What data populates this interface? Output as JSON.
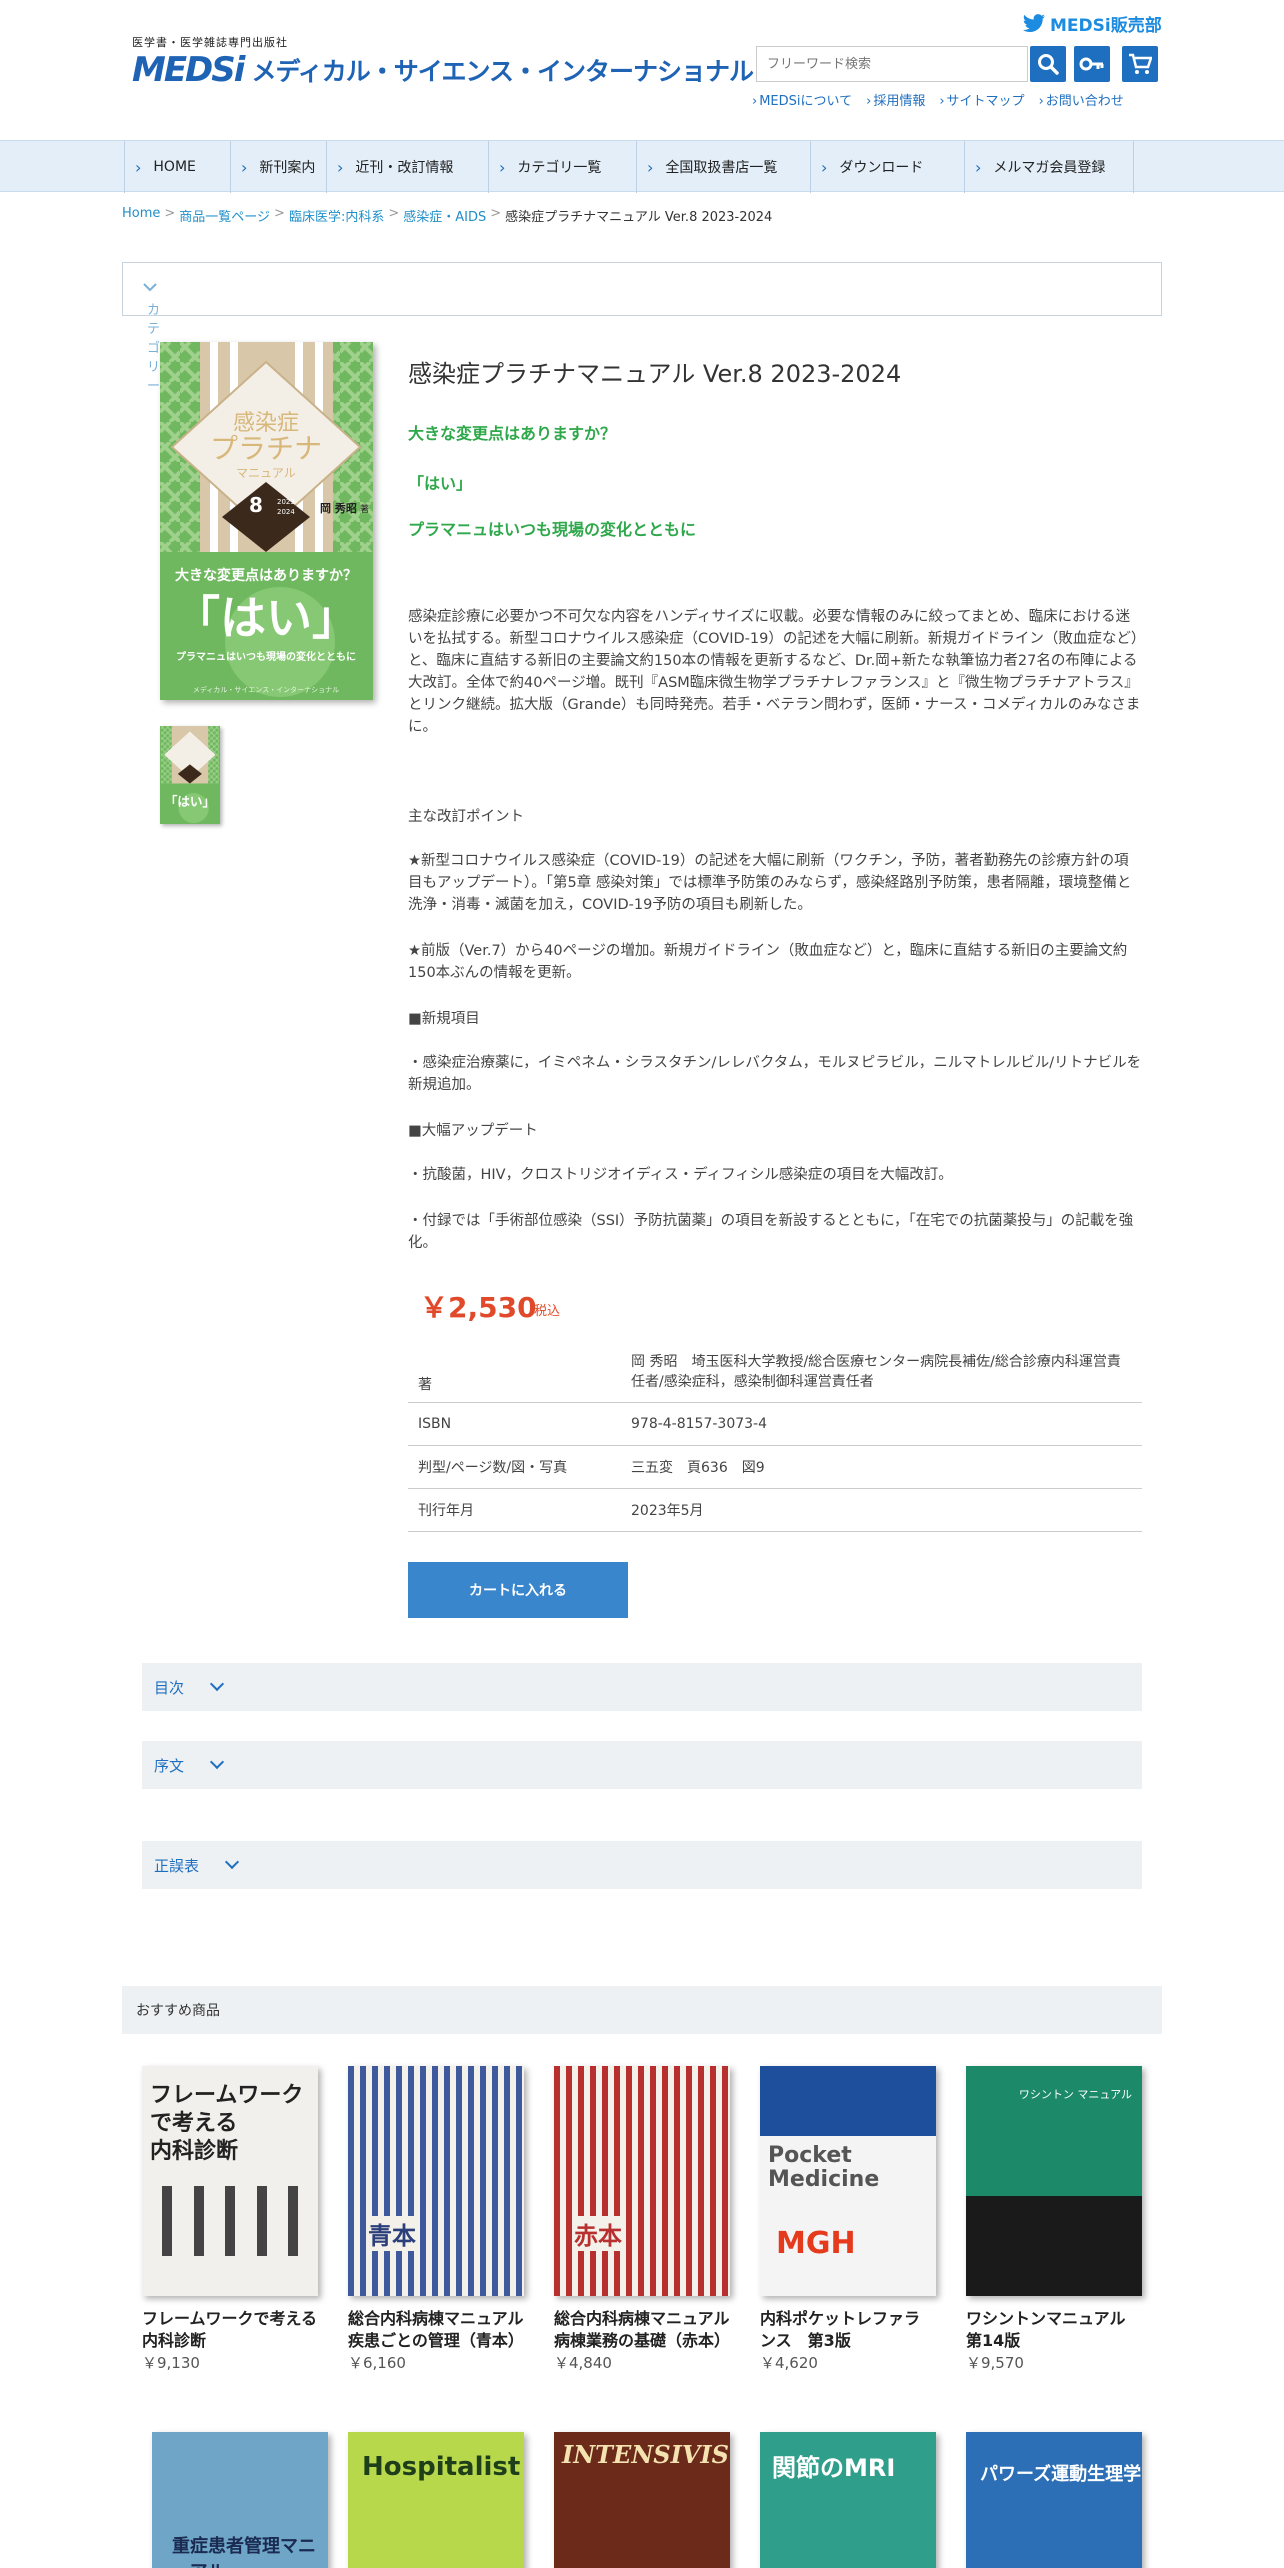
{
  "header": {
    "tagline": "医学書・医学雑誌専門出版社",
    "logo_mark": "MEDSi",
    "logo_name": "メディカル・サイエンス・インターナショナル",
    "twitter_label": "MEDSi販売部",
    "search_placeholder": "フリーワード検索",
    "util_links": [
      "MEDSiについて",
      "採用情報",
      "サイトマップ",
      "お問い合わせ"
    ]
  },
  "nav": [
    "HOME",
    "新刊案内",
    "近刊・改訂情報",
    "カテゴリ一覧",
    "全国取扱書店一覧",
    "ダウンロード",
    "メルマガ会員登録"
  ],
  "breadcrumb": [
    "Home",
    "商品一覧ページ",
    "臨床医学:内科系",
    "感染症・AIDS"
  ],
  "breadcrumb_current": "感染症プラチナマニュアル Ver.8 2023-2024",
  "category_label": "カテゴリー",
  "cover": {
    "title1": "感染症",
    "title2": "プラチナ",
    "title3": "マニュアル",
    "ver": "8",
    "year1": "2023",
    "year2": "2024",
    "author": "岡 秀昭",
    "author_suffix": "著",
    "q": "大きな変更点はありますか？",
    "hai": "「はい」",
    "sub": "プラマニュはいつも現場の変化とともに",
    "publisher": "メディカル・サイエンス・インターナショナル"
  },
  "product": {
    "title": "感染症プラチナマニュアル Ver.8 2023-2024",
    "tag1": "大きな変更点はありますか？",
    "tag2": "「はい」",
    "tag3": "プラマニュはいつも現場の変化とともに",
    "description": "感染症診療に必要かつ不可欠な内容をハンディサイズに収載。必要な情報のみに絞ってまとめ、臨床における迷いを払拭する。新型コロナウイルス感染症（COVID-19）の記述を大幅に刷新。新規ガイドライン（敗血症など）と、臨床に直結する新旧の主要論文約150本の情報を更新するなど、Dr.岡+新たな執筆協力者27名の布陣による大改訂。全体で約40ページ増。既刊『ASM臨床微生物学プラチナレファランス』と『微生物プラチナアトラス』とリンク継続。拡大版（Grande）も同時発売。若手・ベテラン問わず，医師・ナース・コメディカルのみなさまに。",
    "points_heading": "主な改訂ポイント",
    "point1": "★新型コロナウイルス感染症（COVID-19）の記述を大幅に刷新（ワクチン，予防，著者勤務先の診療方針の項目もアップデート）。「第5章 感染対策」では標準予防策のみならず，感染経路別予防策，患者隔離，環境整備と洗浄・消毒・滅菌を加え，COVID-19予防の項目も刷新した。",
    "point2": "★前版（Ver.7）から40ページの増加。新規ガイドライン（敗血症など）と，臨床に直結する新旧の主要論文約150本ぶんの情報を更新。",
    "new_heading": "■新規項目",
    "new_item": "・感染症治療薬に，イミペネム・シラスタチン/レレバクタム，モルヌピラビル，ニルマトレルビル/リトナビルを新規追加。",
    "update_heading": "■大幅アップデート",
    "update1": "・抗酸菌，HIV，クロストリジオイディス・ディフィシル感染症の項目を大幅改訂。",
    "update2": "・付録では「手術部位感染（SSI）予防抗菌薬」の項目を新設するとともに，「在宅での抗菌薬投与」の記載を強化。",
    "price": "￥2,530",
    "price_tax": "税込",
    "specs": [
      {
        "k": "著",
        "v": "岡 秀昭　埼玉医科大学教授/総合医療センター病院長補佐/総合診療内科運営責任者/感染症科，感染制御科運営責任者"
      },
      {
        "k": "ISBN",
        "v": "978-4-8157-3073-4"
      },
      {
        "k": "判型/ページ数/図・写真",
        "v": "三五変　頁636　図9"
      },
      {
        "k": "刊行年月",
        "v": "2023年5月"
      }
    ],
    "cart_label": "カートに入れる"
  },
  "accordions": [
    "目次",
    "序文",
    "正誤表"
  ],
  "recommend": {
    "heading": "おすすめ商品",
    "items": [
      {
        "name": "フレームワークで考える内科診断",
        "price": "￥9,130",
        "cover_text": "フレームワークで考える\n内科診断"
      },
      {
        "name": "総合内科病棟マニュアル　疾患ごとの管理（青本）",
        "price": "￥6,160",
        "cover_text": "青本"
      },
      {
        "name": "総合内科病棟マニュアル　病棟業務の基礎（赤本）",
        "price": "￥4,840",
        "cover_text": "赤本"
      },
      {
        "name": "内科ポケットレファランス　第3版",
        "price": "￥4,620",
        "cover_text": "Pocket\nMedicine"
      },
      {
        "name": "ワシントンマニュアル　第14版",
        "price": "￥9,570",
        "cover_text": "ワシントン マニュアル"
      }
    ],
    "row2": [
      {
        "cover_text": "重症患者管理マニュアル"
      },
      {
        "cover_text": "Hospitalist"
      },
      {
        "cover_text": "INTENSIVIST"
      },
      {
        "cover_text": "関節のMRI"
      },
      {
        "cover_text": "パワーズ運動生理学"
      }
    ]
  }
}
